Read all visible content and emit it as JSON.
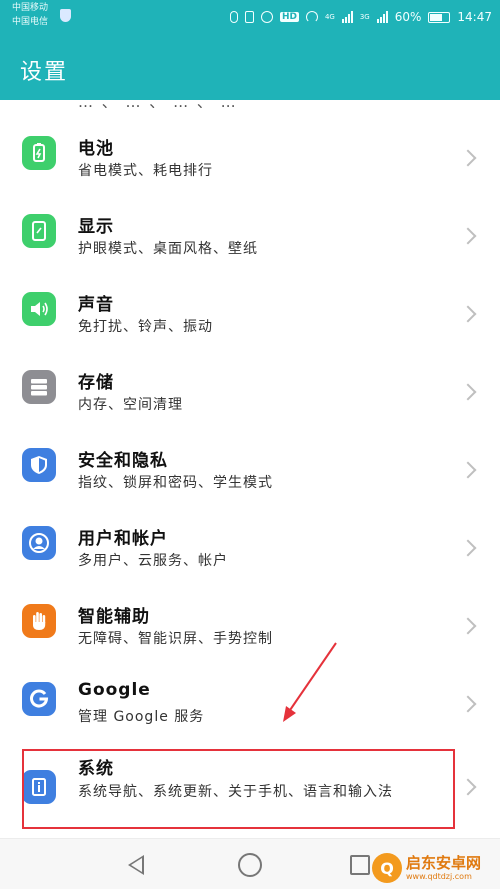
{
  "status_bar": {
    "carrier_1": "中国移动",
    "carrier_2": "中国电信",
    "battery": "60%",
    "time": "14:47",
    "hd_badge": "HD",
    "net_1": "4G",
    "net_2": "3G"
  },
  "app_bar": {
    "title": "设置"
  },
  "partial_item_text": "… 、 … 、 … 、 …",
  "items": [
    {
      "title": "电池",
      "subtitle": "省电模式、耗电排行",
      "icon": "battery-icon",
      "color": "#3ecf6c"
    },
    {
      "title": "显示",
      "subtitle": "护眼模式、桌面风格、壁纸",
      "icon": "display-icon",
      "color": "#3ecf6c"
    },
    {
      "title": "声音",
      "subtitle": "免打扰、铃声、振动",
      "icon": "speaker-icon",
      "color": "#3ecf6c"
    },
    {
      "title": "存储",
      "subtitle": "内存、空间清理",
      "icon": "storage-icon",
      "color": "#8e8e93"
    },
    {
      "title": "安全和隐私",
      "subtitle": "指纹、锁屏和密码、学生模式",
      "icon": "shield-icon",
      "color": "#3f7fe0"
    },
    {
      "title": "用户和帐户",
      "subtitle": "多用户、云服务、帐户",
      "icon": "user-icon",
      "color": "#3f7fe0"
    },
    {
      "title": "智能辅助",
      "subtitle": "无障碍、智能识屏、手势控制",
      "icon": "hand-icon",
      "color": "#f07a1a"
    },
    {
      "title": "Google",
      "subtitle": "管理 Google 服务",
      "icon": "google-icon",
      "color": "#3f7fe0"
    },
    {
      "title": "系统",
      "subtitle": "系统导航、系统更新、关于手机、语言和输入法",
      "icon": "info-icon",
      "color": "#3f7fe0"
    }
  ],
  "watermark": {
    "name": "启东安卓网",
    "url": "www.qdtdzj.com",
    "logo_char": "Q"
  }
}
